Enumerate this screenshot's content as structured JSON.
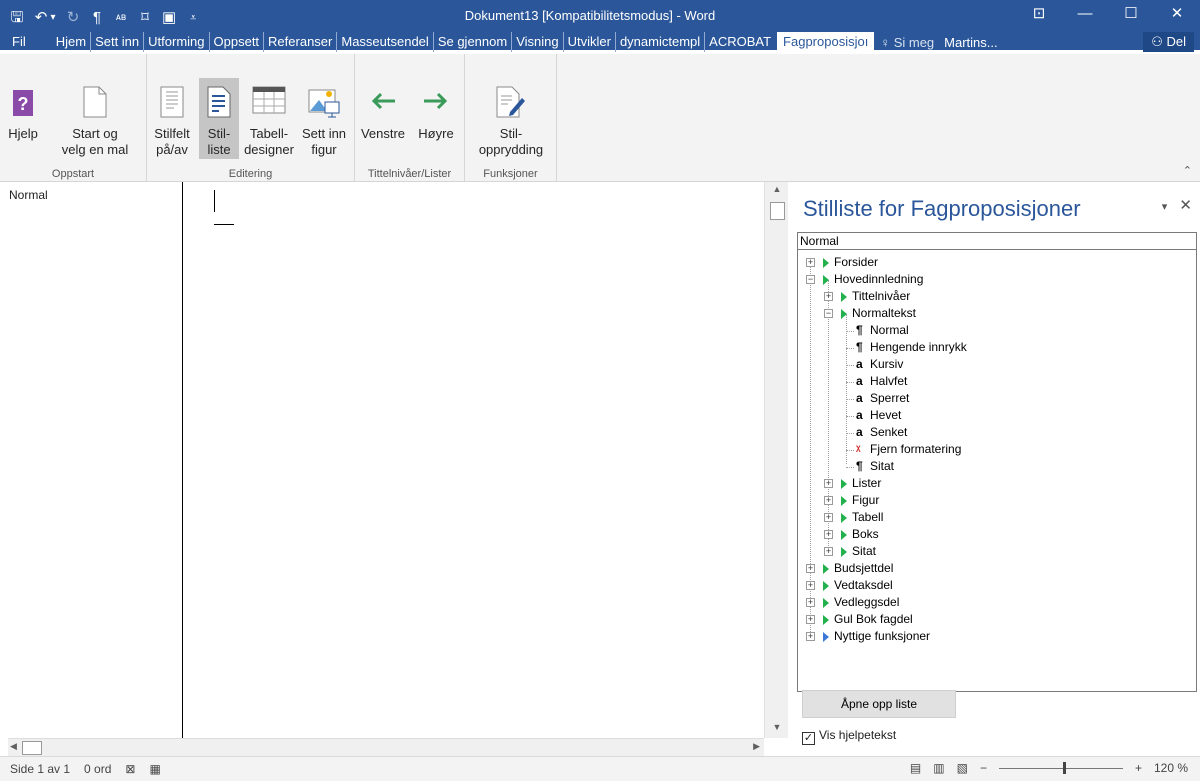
{
  "titlebar": {
    "title": "Dokument13 [Kompatibilitetsmodus] - Word",
    "qat": {
      "save": "🖫",
      "undo": "↶",
      "undo_dd": "▾",
      "redo": "↻",
      "pilcrow": "¶",
      "abc": "ᴀʙ",
      "custom1": "⌑",
      "custom2": "▣",
      "more": "⩡"
    },
    "controls": {
      "ribbon_display": "⊡",
      "minimize": "—",
      "maximize": "☐",
      "close": "✕"
    }
  },
  "tabs": {
    "file": "Fil",
    "items": [
      "Hjem",
      "Sett inn",
      "Utforming",
      "Oppsett",
      "Referanser",
      "Masseutsendel",
      "Se gjennom",
      "Visning",
      "Utvikler",
      "dynamictempl",
      "ACROBAT"
    ],
    "active": "Fagproposisjoı",
    "tell_me": "Si meg",
    "user": "Martins...",
    "share": "Del"
  },
  "ribbon": {
    "groups": {
      "oppstart": "Oppstart",
      "editering": "Editering",
      "tittel": "Tittelnivåer/Lister",
      "funksjoner": "Funksjoner"
    },
    "buttons": {
      "hjelp": "Hjelp",
      "start1": "Start og",
      "start2": "velg en mal",
      "stilfelt1": "Stilfelt",
      "stilfelt2": "på/av",
      "stilliste1": "Stil-",
      "stilliste2": "liste",
      "tabell1": "Tabell-",
      "tabell2": "designer",
      "figur1": "Sett inn",
      "figur2": "figur",
      "venstre": "Venstre",
      "hoyre": "Høyre",
      "opprydding1": "Stil-",
      "opprydding2": "opprydding"
    }
  },
  "document": {
    "style_area_label": "Normal"
  },
  "pane": {
    "title": "Stilliste for Fagproposisjoner",
    "pin": "▾",
    "close": "✕",
    "style_value": "Normal",
    "tree": {
      "forsider": "Forsider",
      "hovedinnledning": "Hovedinnledning",
      "tittelnivaer": "Tittelnivåer",
      "normaltekst": "Normaltekst",
      "normal": "Normal",
      "hengende": "Hengende innrykk",
      "kursiv": "Kursiv",
      "halvfet": "Halvfet",
      "sperret": "Sperret",
      "hevet": "Hevet",
      "senket": "Senket",
      "fjern": "Fjern formatering",
      "sitat_leaf": "Sitat",
      "lister": "Lister",
      "figur": "Figur",
      "tabell": "Tabell",
      "boks": "Boks",
      "sitat": "Sitat",
      "budsjettdel": "Budsjettdel",
      "vedtaksdel": "Vedtaksdel",
      "vedleggsdel": "Vedleggsdel",
      "gulbok": "Gul Bok fagdel",
      "nyttige": "Nyttige funksjoner"
    },
    "open_list": "Åpne opp liste",
    "show_help": "Vis hjelpetekst",
    "show_help_checked": true
  },
  "statusbar": {
    "page": "Side 1 av 1",
    "words": "0 ord",
    "zoom": "120 %",
    "zoom_percent": 120
  },
  "colors": {
    "title_blue": "#2b579a",
    "tree_green": "#22b14c",
    "tree_blue": "#3c78d8"
  }
}
